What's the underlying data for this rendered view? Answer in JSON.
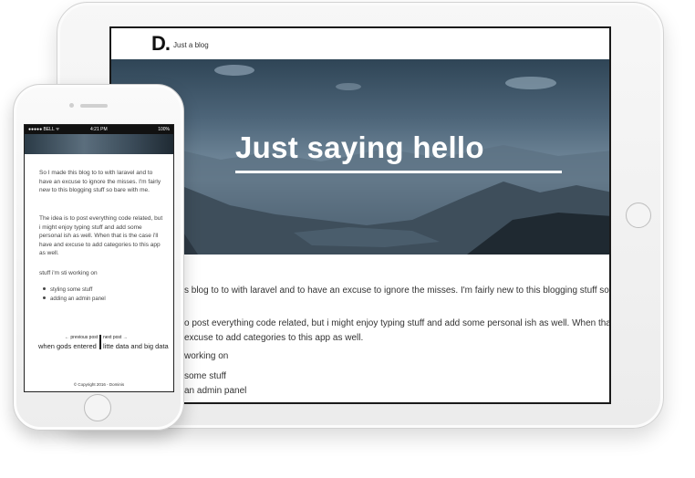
{
  "tablet": {
    "nav": {
      "logo": "D.",
      "tagline": "Just a blog"
    },
    "hero": {
      "title": "Just saying hello"
    },
    "body": {
      "p1": "s blog to to with laravel and to have an excuse to ignore the misses. I'm fairly new to this blogging stuff so bare with",
      "p2": "o post everything code related, but i might enjoy typing stuff and add some personal ish as well. When that is the case",
      "p2b": "excuse to add categories to this app as well.",
      "p3": "working on",
      "li1": "some stuff",
      "li2": "an admin panel"
    }
  },
  "phone": {
    "status": {
      "carrier": "●●●●● BELL ᯤ",
      "time": "4:21 PM",
      "battery": "100%"
    },
    "body": {
      "p1": "So I made this blog to to with laravel and to have an excuse to ignore the misses. I'm fairly new to this blogging stuff so bare with me.",
      "p2": "The idea is to post everything code related, but i might enjoy typing stuff and add some personal ish as well. When that is the case i'll have and excuse to add categories to this app as well.",
      "p3": "stuff i'm sti working on",
      "li1": "styling some stuff",
      "li2": "adding an admin panel"
    },
    "nav": {
      "prev_label": "← previous post",
      "prev_title": "when gods entered",
      "next_label": "next post →",
      "next_title": "litte data and big data"
    },
    "footer": "© Copyright 2016 - Dominis"
  }
}
